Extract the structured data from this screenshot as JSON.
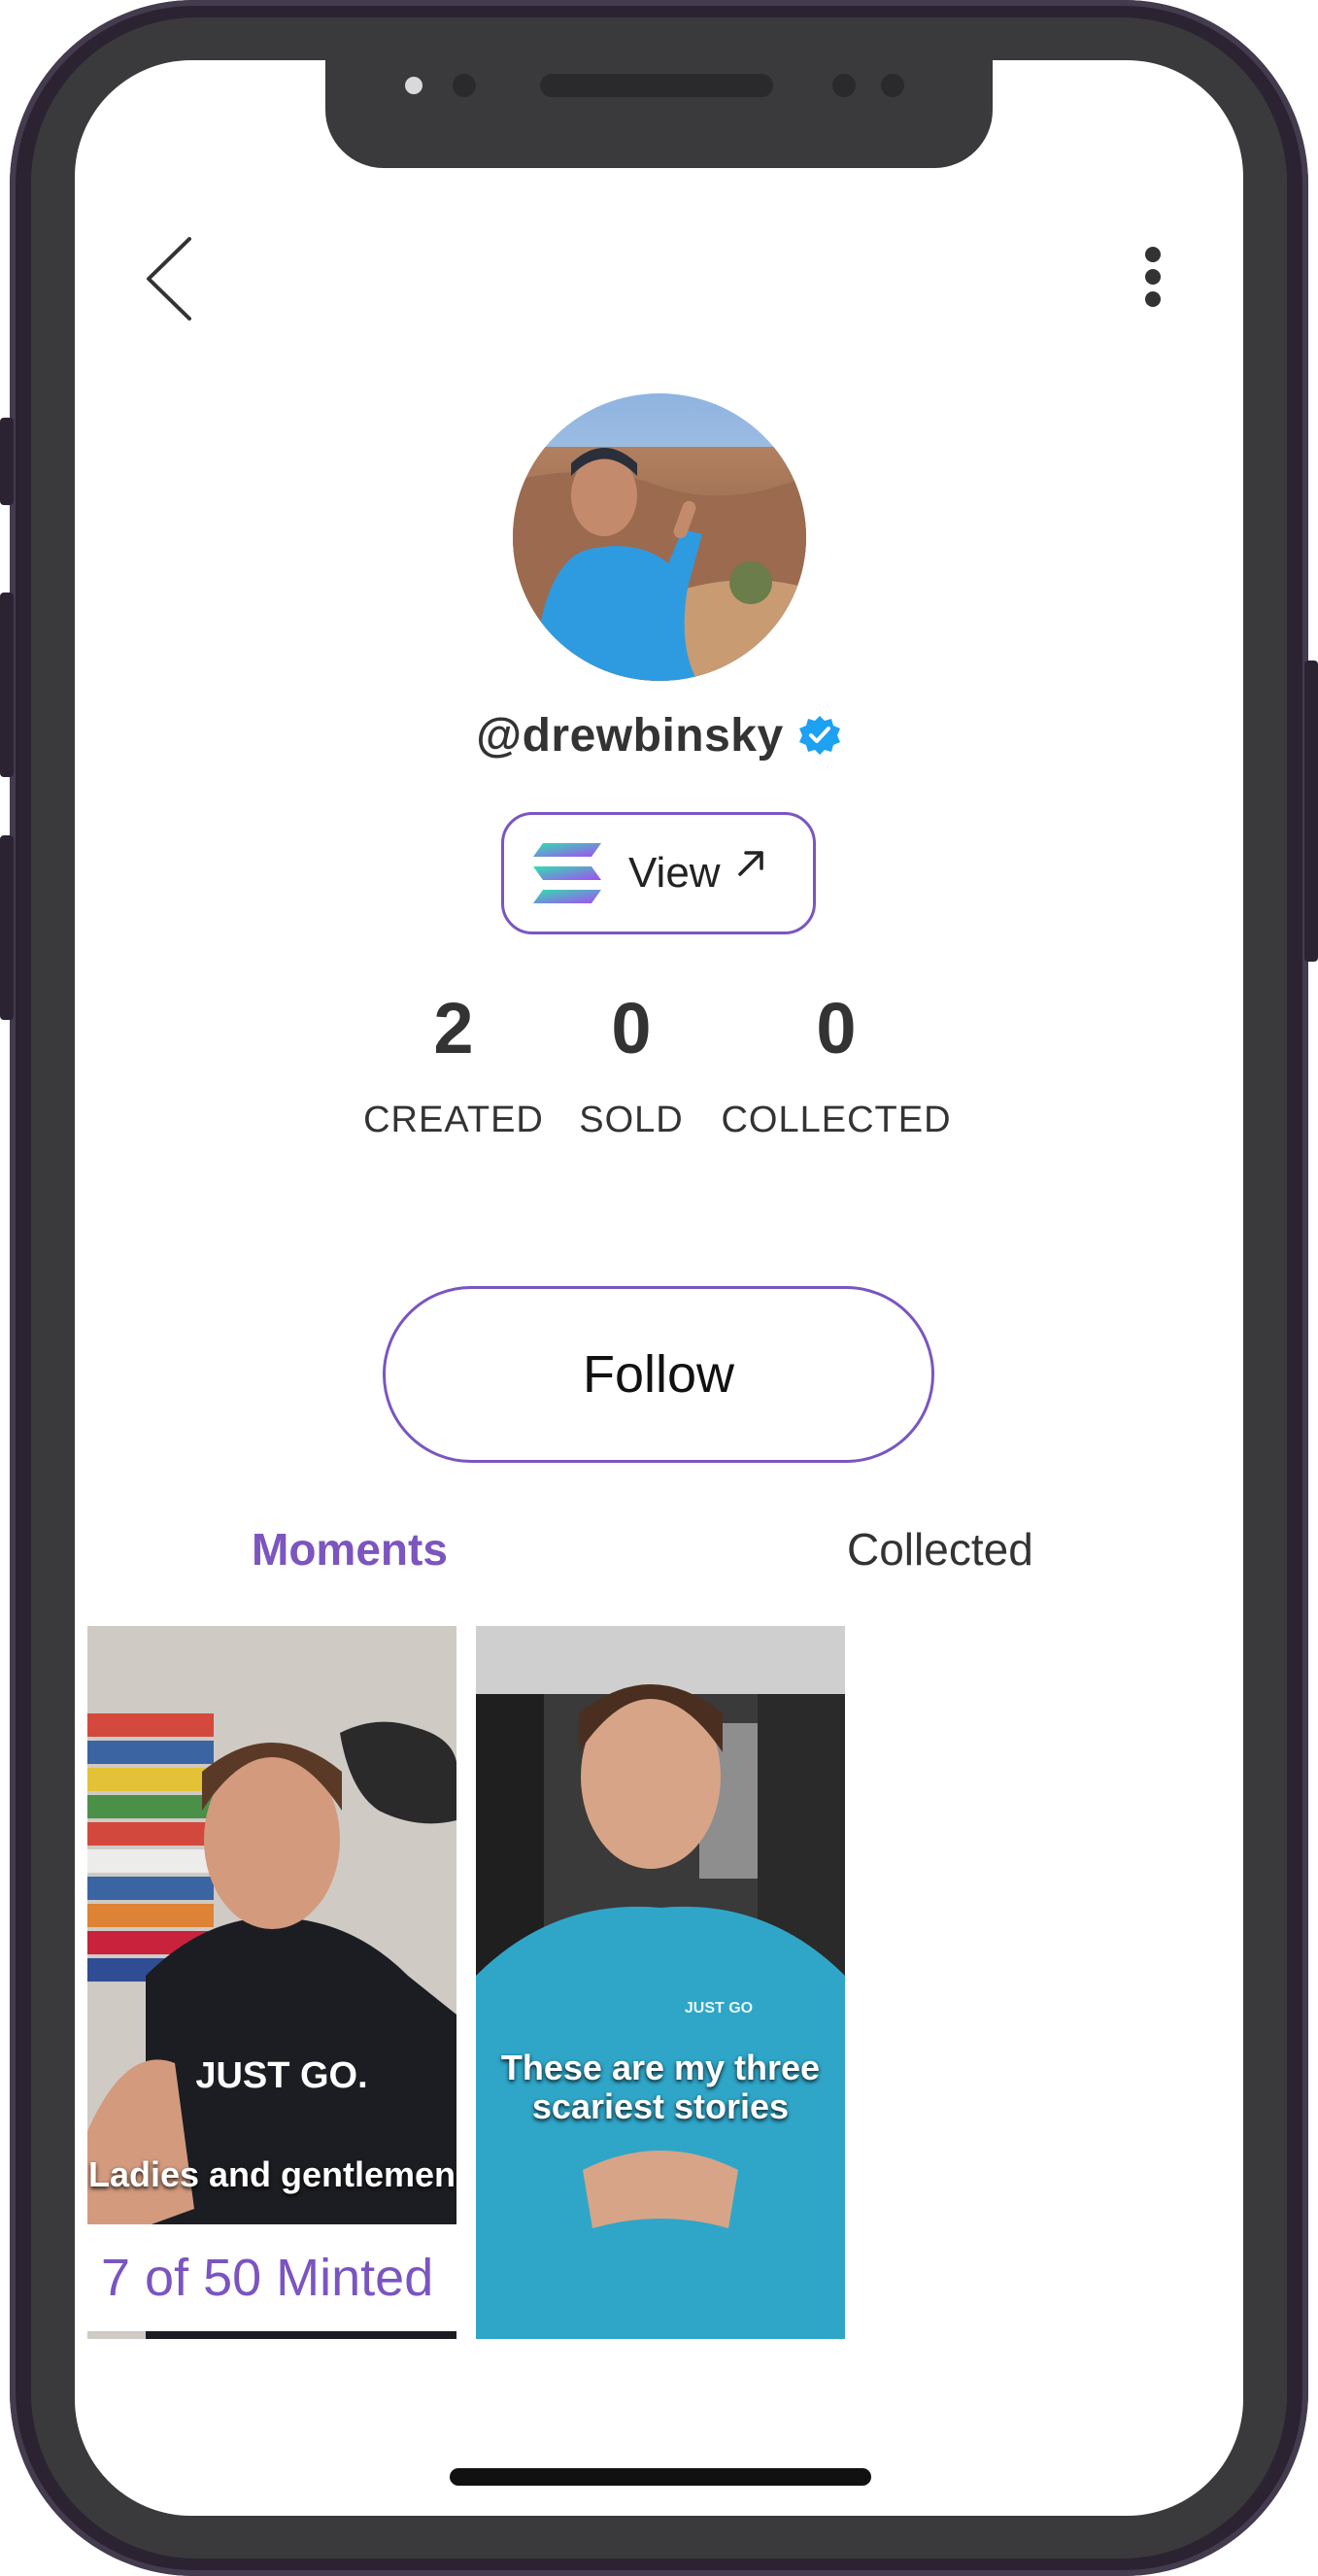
{
  "profile": {
    "handle": "@drewbinsky",
    "verified": true,
    "view_label": "View"
  },
  "stats": [
    {
      "value": "2",
      "label": "CREATED"
    },
    {
      "value": "0",
      "label": "SOLD"
    },
    {
      "value": "0",
      "label": "COLLECTED"
    }
  ],
  "follow_label": "Follow",
  "tabs": [
    {
      "label": "Moments",
      "active": true
    },
    {
      "label": "Collected",
      "active": false
    }
  ],
  "moments": [
    {
      "shirt_text": "JUST GO.",
      "caption": "Ladies and gentlemen",
      "mint_label": "7 of 50 Minted"
    },
    {
      "shirt_text": "JUST GO",
      "caption": "These are my three scariest stories"
    }
  ],
  "colors": {
    "accent": "#7a55c2",
    "verified_badge": "#1da1f2",
    "text": "#333333"
  }
}
